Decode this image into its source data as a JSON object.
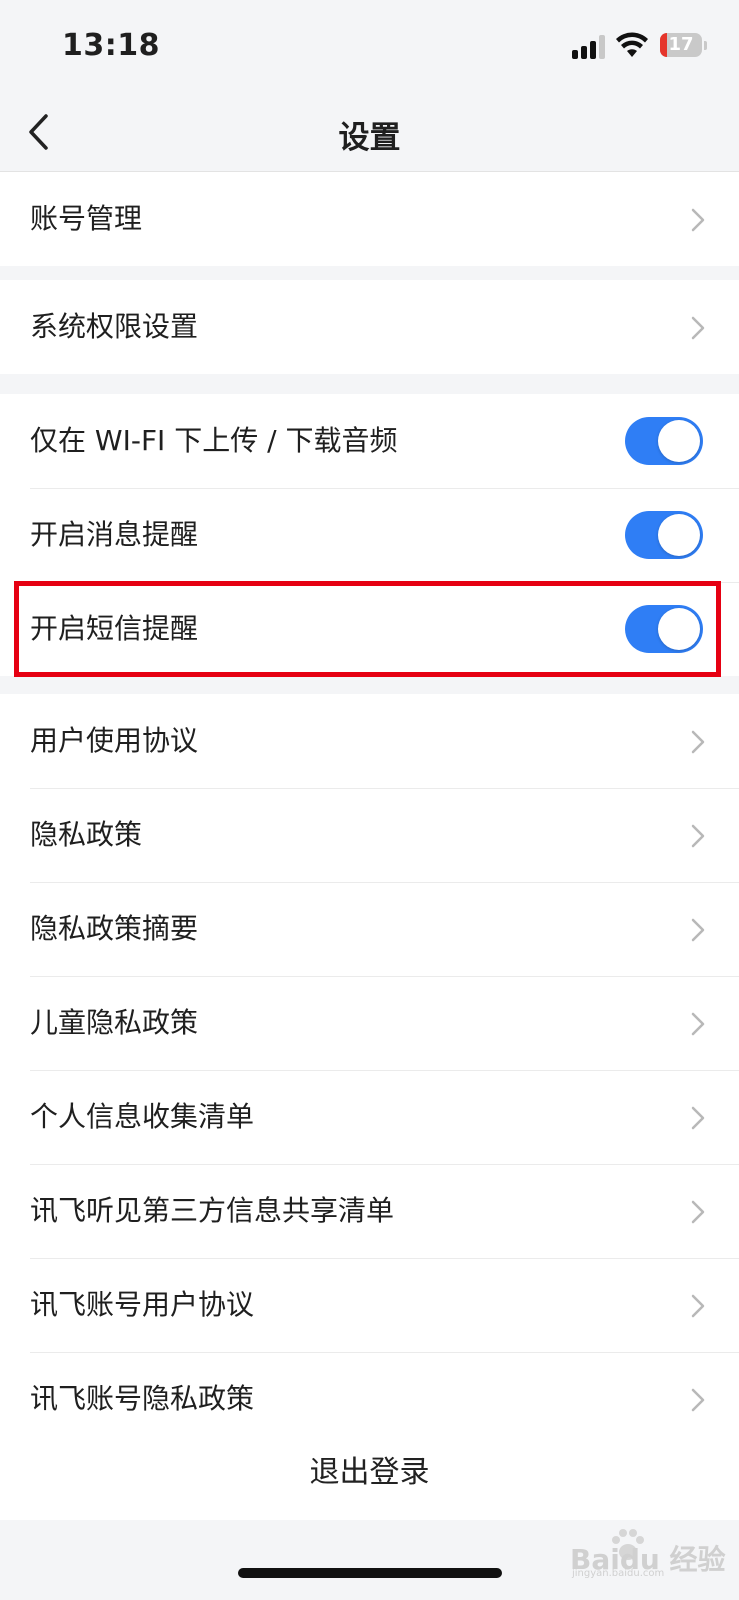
{
  "status_bar": {
    "time": "13:18",
    "battery_level": "17",
    "battery_fill_percent": 16,
    "battery_color": "#e5352b",
    "signal_bars_active": 3
  },
  "nav": {
    "title": "设置",
    "back_icon": "chevron-left-icon"
  },
  "groups": {
    "account": {
      "items": [
        {
          "label": "账号管理",
          "icon": "chevron-right-icon"
        }
      ]
    },
    "permissions": {
      "items": [
        {
          "label": "系统权限设置",
          "icon": "chevron-right-icon"
        }
      ]
    },
    "toggles": {
      "items": [
        {
          "label": "仅在 WI-FI 下上传 / 下载音频",
          "on": true
        },
        {
          "label": "开启消息提醒",
          "on": true
        },
        {
          "label": "开启短信提醒",
          "on": true,
          "highlighted": true
        }
      ],
      "accent_color": "#2f7ef5"
    },
    "legal": {
      "items": [
        {
          "label": "用户使用协议"
        },
        {
          "label": "隐私政策"
        },
        {
          "label": "隐私政策摘要"
        },
        {
          "label": "儿童隐私政策"
        },
        {
          "label": "个人信息收集清单"
        },
        {
          "label": "讯飞听见第三方信息共享清单"
        },
        {
          "label": "讯飞账号用户协议"
        },
        {
          "label": "讯飞账号隐私政策"
        }
      ]
    }
  },
  "logout": {
    "label": "退出登录"
  },
  "watermark": {
    "brand": "Baidu 经验",
    "sub": "jingyan.baidu.com"
  },
  "highlight_color": "#e60012"
}
